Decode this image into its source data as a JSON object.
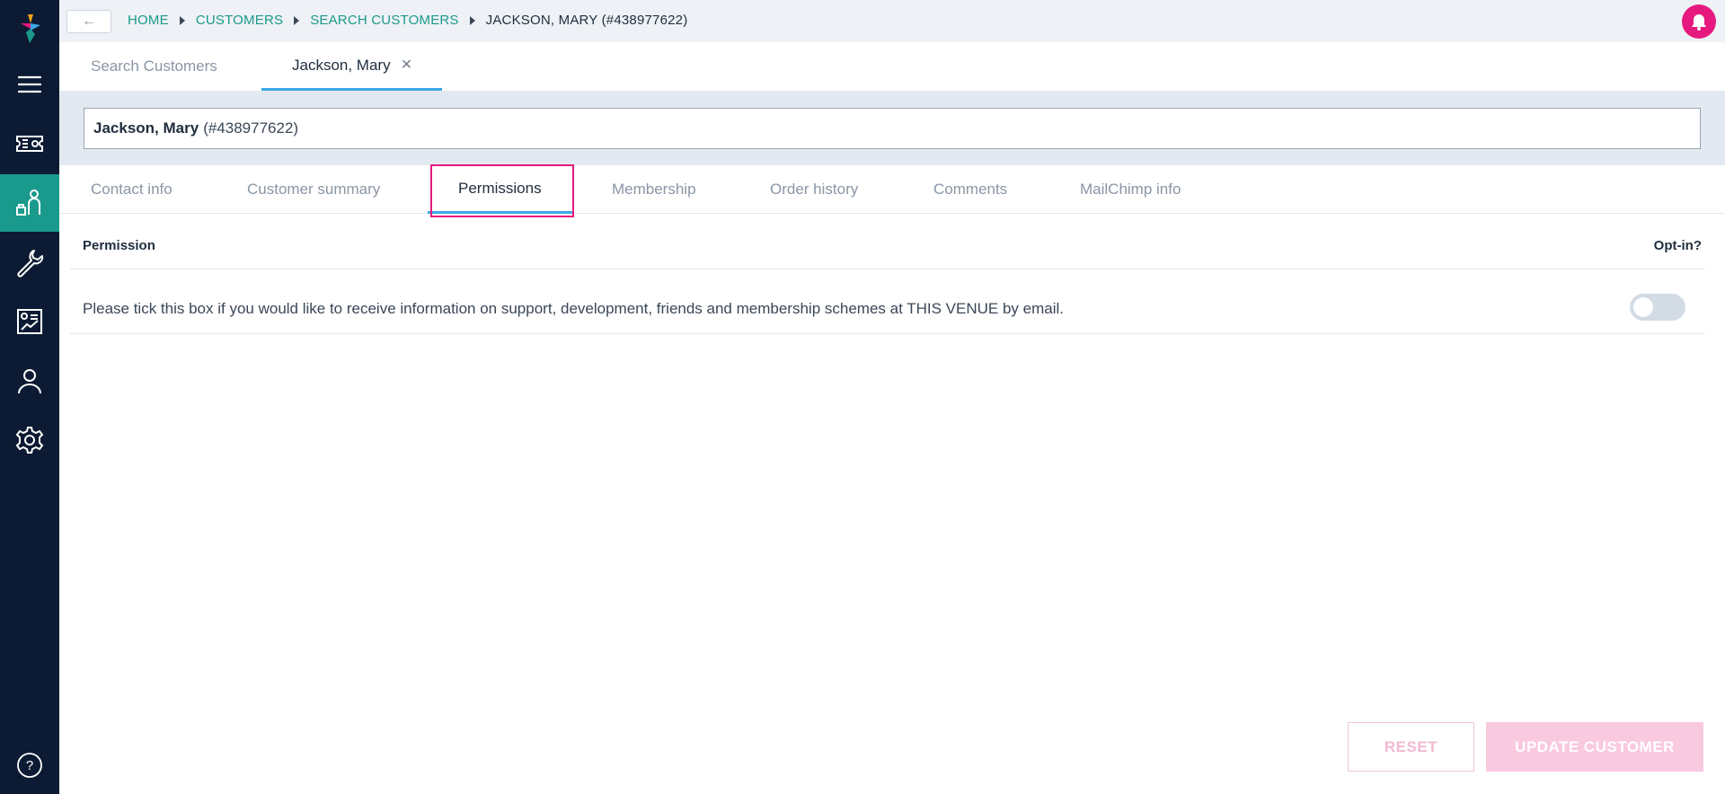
{
  "nav": {
    "items": [
      {
        "name": "menu-icon"
      },
      {
        "name": "ticket-icon"
      },
      {
        "name": "customer-icon",
        "active": true
      },
      {
        "name": "wrench-icon"
      },
      {
        "name": "report-icon"
      },
      {
        "name": "user-icon"
      },
      {
        "name": "gear-icon"
      }
    ]
  },
  "topbar": {
    "back_label": "←",
    "breadcrumbs": [
      "HOME",
      "CUSTOMERS",
      "SEARCH CUSTOMERS"
    ],
    "current": "JACKSON, MARY (#438977622)"
  },
  "page_tabs": [
    {
      "label": "Search Customers"
    },
    {
      "label": "Jackson, Mary",
      "closable": true
    }
  ],
  "customer": {
    "name": "Jackson, Mary",
    "id": "(#438977622)"
  },
  "sub_tabs": [
    "Contact info",
    "Customer summary",
    "Permissions",
    "Membership",
    "Order history",
    "Comments",
    "MailChimp info"
  ],
  "permissions": {
    "header_left": "Permission",
    "header_right": "Opt-in?",
    "rows": [
      {
        "text": "Please tick this box if you would like to receive information on support, development, friends and membership schemes at THIS VENUE by email.",
        "opted_in": false
      }
    ]
  },
  "actions": {
    "reset": "RESET",
    "update": "UPDATE CUSTOMER"
  },
  "colors": {
    "sidebar": "#0c1b33",
    "accent_teal": "#1a9a8c",
    "accent_pink": "#e6197f",
    "tab_underline": "#3aa8e6"
  }
}
